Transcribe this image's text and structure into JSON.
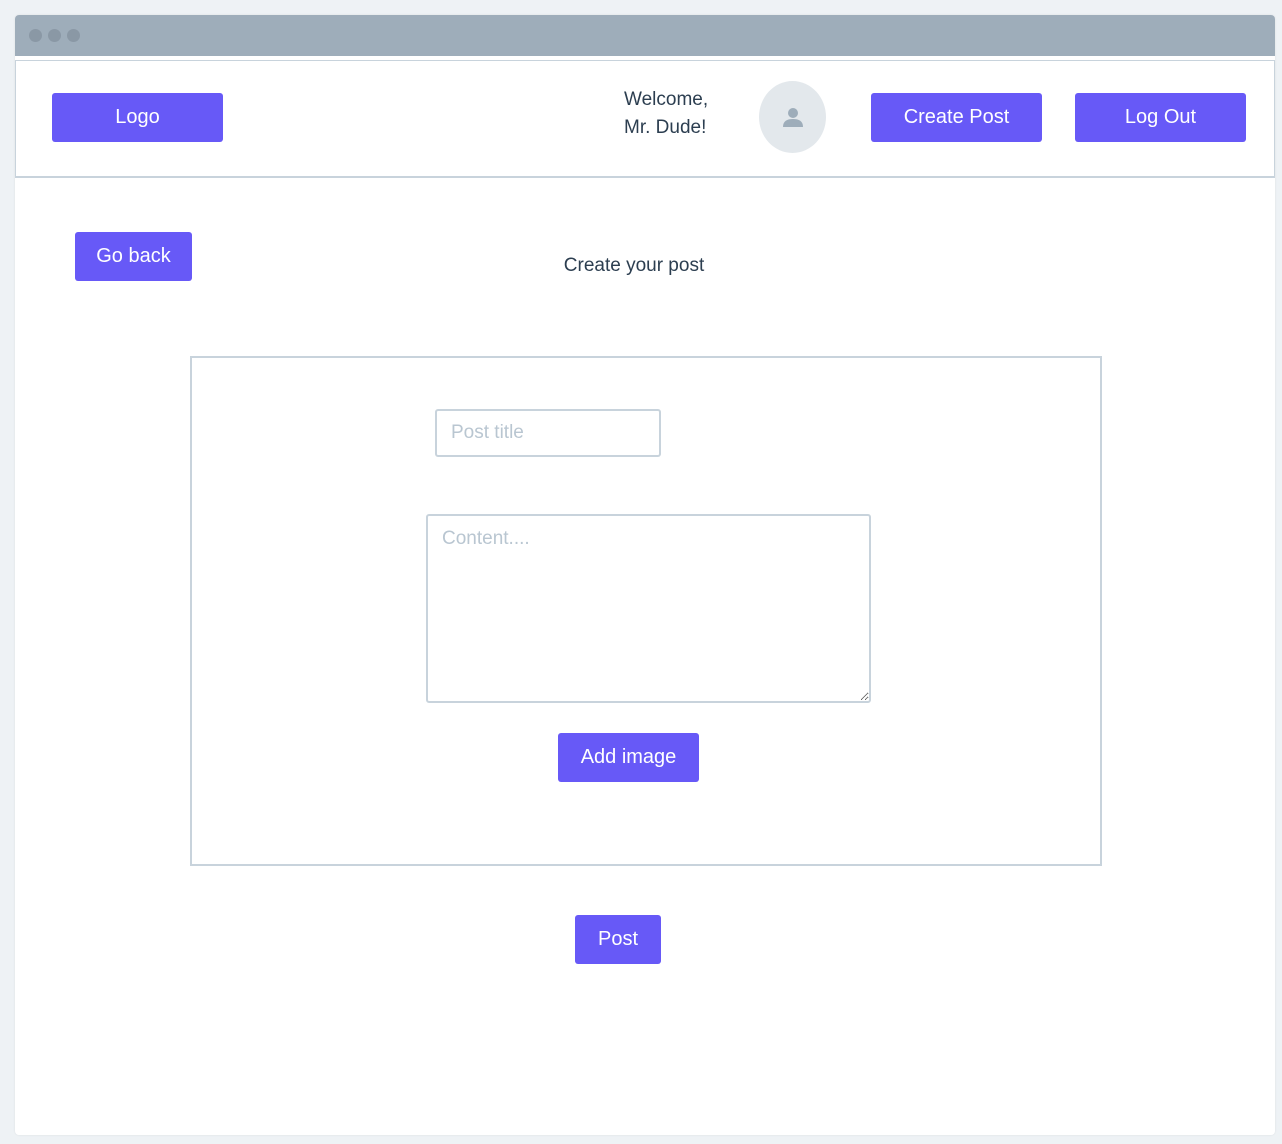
{
  "header": {
    "logo_label": "Logo",
    "welcome_line1": "Welcome,",
    "welcome_line2": "Mr. Dude!",
    "avatar_icon": "user-icon",
    "create_post_label": "Create Post",
    "logout_label": "Log Out"
  },
  "page": {
    "go_back_label": "Go back",
    "title": "Create your post"
  },
  "form": {
    "title_placeholder": "Post title",
    "title_value": "",
    "content_placeholder": "Content....",
    "content_value": "",
    "add_image_label": "Add image"
  },
  "actions": {
    "post_label": "Post"
  },
  "colors": {
    "accent": "#6759f7",
    "titlebar": "#9eadba",
    "border": "#c8d3dc",
    "text": "#2c3e50",
    "placeholder": "#b9c6d1"
  }
}
